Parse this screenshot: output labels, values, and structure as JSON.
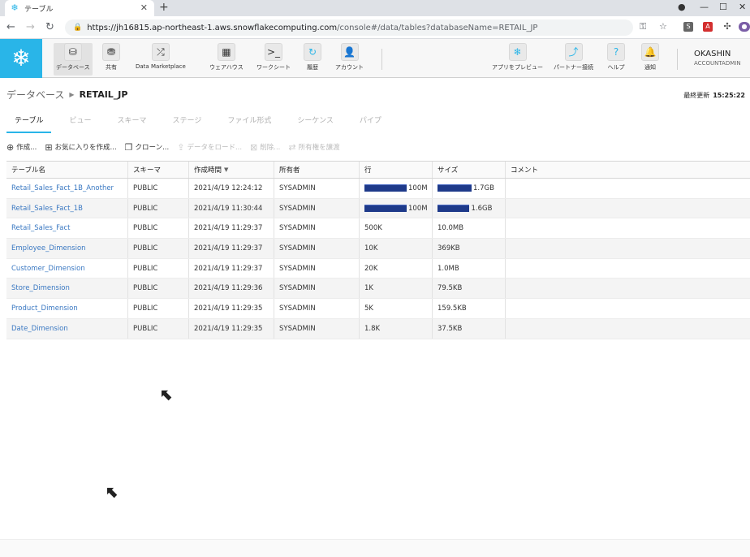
{
  "browser": {
    "tab_title": "テーブル",
    "url_host": "https://jh16815.ap-northeast-1.aws.snowflakecomputing.com",
    "url_path": "/console#/data/tables?databaseName=RETAIL_JP"
  },
  "nav": {
    "items": [
      {
        "label": "データベース",
        "icon": "database-icon"
      },
      {
        "label": "共有",
        "icon": "share-icon"
      },
      {
        "label": "Data Marketplace",
        "icon": "shuffle-icon"
      },
      {
        "label": "ウェアハウス",
        "icon": "warehouse-icon"
      },
      {
        "label": "ワークシート",
        "icon": "terminal-icon"
      },
      {
        "label": "履歴",
        "icon": "history-icon"
      },
      {
        "label": "アカウント",
        "icon": "account-icon"
      }
    ],
    "right_items": [
      {
        "label": "アプリをプレビュー",
        "icon": "snowflake-icon"
      },
      {
        "label": "パートナー接続",
        "icon": "connect-icon"
      },
      {
        "label": "ヘルプ",
        "icon": "help-icon"
      },
      {
        "label": "通知",
        "icon": "bell-icon"
      }
    ],
    "user_name": "OKASHIN",
    "user_role": "ACCOUNTADMIN"
  },
  "breadcrumb": {
    "root": "データベース",
    "current": "RETAIL_JP"
  },
  "last_updated": {
    "label": "最終更新",
    "time": "15:25:22"
  },
  "tabs": [
    "テーブル",
    "ビュー",
    "スキーマ",
    "ステージ",
    "ファイル形式",
    "シーケンス",
    "パイプ"
  ],
  "toolbar": [
    {
      "label": "作成...",
      "icon": "plus-circle-icon",
      "enabled": true
    },
    {
      "label": "お気に入りを作成...",
      "icon": "add-favorite-icon",
      "enabled": true
    },
    {
      "label": "クローン...",
      "icon": "clone-icon",
      "enabled": true
    },
    {
      "label": "データをロード...",
      "icon": "load-icon",
      "enabled": false
    },
    {
      "label": "削除...",
      "icon": "delete-icon",
      "enabled": false
    },
    {
      "label": "所有権を譲渡",
      "icon": "transfer-icon",
      "enabled": false
    }
  ],
  "table": {
    "columns": [
      "テーブル名",
      "スキーマ",
      "作成時間",
      "所有者",
      "行",
      "サイズ",
      "コメント"
    ],
    "rows": [
      {
        "name": "Retail_Sales_Fact_1B_Another",
        "schema": "PUBLIC",
        "created": "2021/4/19 12:24:12",
        "owner": "SYSADMIN",
        "rows": "100M",
        "size": "1.7GB",
        "rows_frac": 1.0,
        "size_frac": 1.0
      },
      {
        "name": "Retail_Sales_Fact_1B",
        "schema": "PUBLIC",
        "created": "2021/4/19 11:30:44",
        "owner": "SYSADMIN",
        "rows": "100M",
        "size": "1.6GB",
        "rows_frac": 1.0,
        "size_frac": 0.94
      },
      {
        "name": "Retail_Sales_Fact",
        "schema": "PUBLIC",
        "created": "2021/4/19 11:29:37",
        "owner": "SYSADMIN",
        "rows": "500K",
        "size": "10.0MB",
        "rows_frac": 0,
        "size_frac": 0
      },
      {
        "name": "Employee_Dimension",
        "schema": "PUBLIC",
        "created": "2021/4/19 11:29:37",
        "owner": "SYSADMIN",
        "rows": "10K",
        "size": "369KB",
        "rows_frac": 0,
        "size_frac": 0
      },
      {
        "name": "Customer_Dimension",
        "schema": "PUBLIC",
        "created": "2021/4/19 11:29:37",
        "owner": "SYSADMIN",
        "rows": "20K",
        "size": "1.0MB",
        "rows_frac": 0,
        "size_frac": 0
      },
      {
        "name": "Store_Dimension",
        "schema": "PUBLIC",
        "created": "2021/4/19 11:29:36",
        "owner": "SYSADMIN",
        "rows": "1K",
        "size": "79.5KB",
        "rows_frac": 0,
        "size_frac": 0
      },
      {
        "name": "Product_Dimension",
        "schema": "PUBLIC",
        "created": "2021/4/19 11:29:35",
        "owner": "SYSADMIN",
        "rows": "5K",
        "size": "159.5KB",
        "rows_frac": 0,
        "size_frac": 0
      },
      {
        "name": "Date_Dimension",
        "schema": "PUBLIC",
        "created": "2021/4/19 11:29:35",
        "owner": "SYSADMIN",
        "rows": "1.8K",
        "size": "37.5KB",
        "rows_frac": 0,
        "size_frac": 0
      }
    ]
  },
  "colors": {
    "accent": "#29b5e8",
    "bar": "#1e3a8a",
    "link": "#3a78c2"
  }
}
